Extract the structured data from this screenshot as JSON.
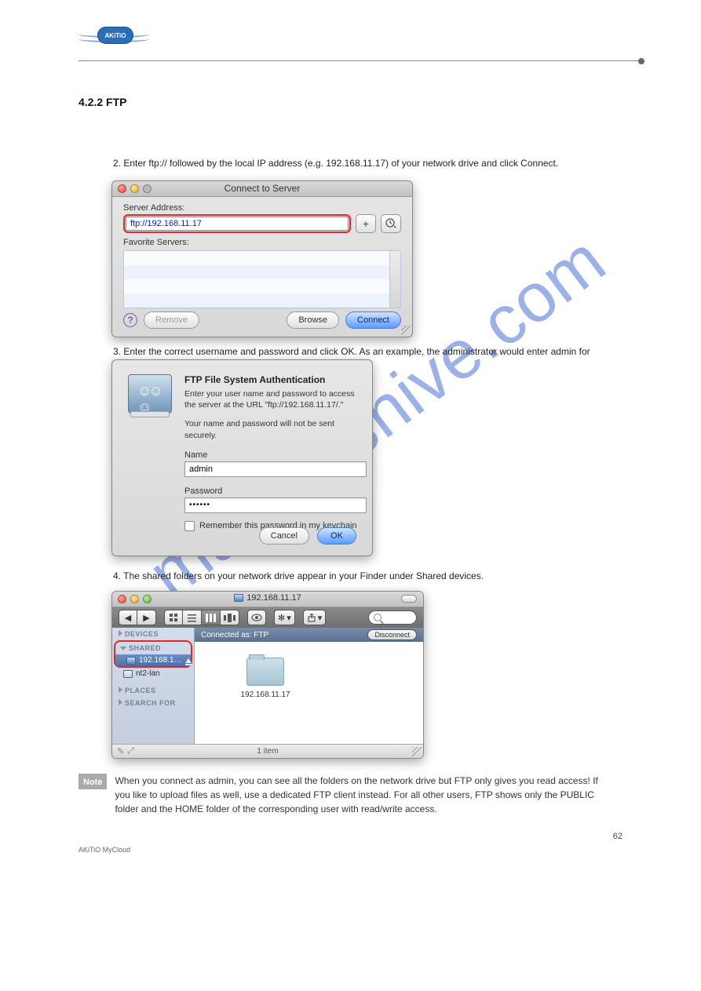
{
  "logo_text": "AKiTiO",
  "watermark": "manualshive.com",
  "texts": {
    "heading": "4.2.2 FTP",
    "step2": "2. Enter ftp:// followed by the local IP address (e.g. 192.168.11.17) of your network drive and click Connect.",
    "step3": "3. Enter the correct username and password and click OK. As an example, the administrator would enter admin for both the username and the password.",
    "step4": "4. The shared folders on your network drive appear in your Finder under Shared devices.",
    "note_label": "Note",
    "note_body": "When you connect as admin, you can see all the folders on the network drive but FTP only gives you read access! If you like to upload files as well, use a dedicated FTP client instead. For all other users, FTP shows only the PUBLIC folder and the HOME folder of the corresponding user with read/write access.",
    "page_num": "62",
    "footer": "AKiTiO MyCloud"
  },
  "dlg1": {
    "title": "Connect to Server",
    "server_address_label": "Server Address:",
    "server_address_value": "ftp://192.168.11.17",
    "plus": "+",
    "favorite_label": "Favorite Servers:",
    "help": "?",
    "remove": "Remove",
    "browse": "Browse",
    "connect": "Connect"
  },
  "dlg2": {
    "title": "FTP File System Authentication",
    "line1": "Enter your user name and password to access the server at the URL \"ftp://192.168.11.17/.\"",
    "line2": "Your name and password will not be sent securely.",
    "name_label": "Name",
    "name_value": "admin",
    "pw_label": "Password",
    "pw_value": "••••••",
    "remember": "Remember this password in my keychain",
    "cancel": "Cancel",
    "ok": "OK"
  },
  "finder": {
    "title": "192.168.11.17",
    "nav_back": "◀",
    "nav_fwd": "▶",
    "gear": "✻",
    "connected_as": "Connected as: FTP",
    "disconnect": "Disconnect",
    "devices": "DEVICES",
    "shared": "SHARED",
    "places": "PLACES",
    "searchfor": "SEARCH FOR",
    "sb_item_sel": "192.168.1…",
    "sb_item_2": "nt2-lan",
    "folder_name": "192.168.11.17",
    "status": "1 item"
  }
}
